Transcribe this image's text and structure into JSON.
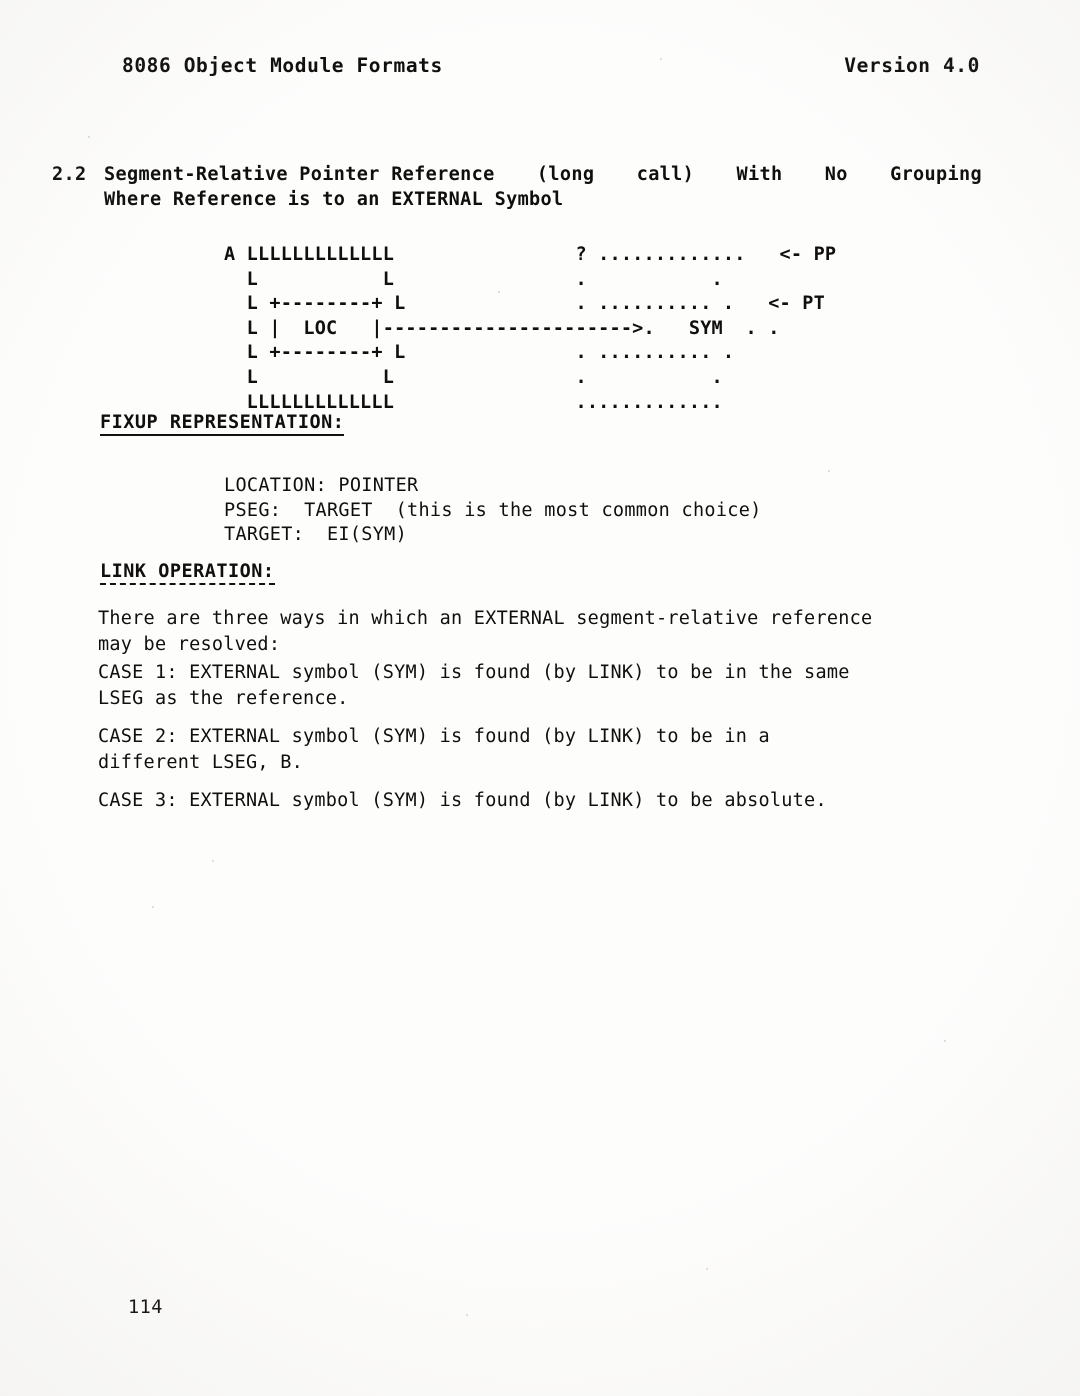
{
  "document": {
    "running_head_left": "8086 Object Module Formats",
    "running_head_right": "Version 4.0",
    "page_number": "114"
  },
  "section": {
    "number": "2.2",
    "title_line1_a": "Segment-Relative Pointer Reference",
    "title_line1_b": "(long",
    "title_line1_c": "call)",
    "title_line1_d": "With",
    "title_line1_e": "No",
    "title_line1_f": "Grouping",
    "title_line2": "Where Reference is to an EXTERNAL Symbol"
  },
  "diagram": {
    "line1": "A LLLLLLLLLLLLL                ? .............   <- PP",
    "line2": "  L           L                .           .",
    "line3": "  L +--------+ L               . .......... .   <- PT",
    "line4": "  L |  LOC   |---------------------->.   SYM  . .",
    "line5": "  L +--------+ L               . .......... .",
    "line6": "  L           L                .           .",
    "line7": "  LLLLLLLLLLLLL                .............",
    "labels": {
      "box_label": "LOC",
      "symbol_label": "SYM",
      "frame_label": "A",
      "unknown_frame": "?",
      "pointer_pointer": "<- PP",
      "pointer_target": "<- PT"
    }
  },
  "fixup": {
    "heading": "FIXUP REPRESENTATION:",
    "line_location": "LOCATION: POINTER",
    "line_pseg": "PSEG:  TARGET  (this is the most common choice)",
    "line_target": "TARGET:  EI(SYM)"
  },
  "link_operation": {
    "heading": "LINK OPERATION:",
    "intro_line1": "There  are three ways in which an EXTERNAL segment-relative reference",
    "intro_line2": "may be resolved:",
    "case1_line1": "CASE 1:  EXTERNAL symbol (SYM) is found (by LINK) to be in  the  same",
    "case1_line2": "LSEG as the reference.",
    "case2_line1": "CASE  2:   EXTERNAL  symbol  (SYM)  is  found  (by  LINK)  to be in a",
    "case2_line2": "different LSEG, B.",
    "case3_line1": "CASE 3:  EXTERNAL symbol (SYM) is found (by LINK) to be absolute."
  },
  "colors": {
    "ink": "#100f0d",
    "paper": "#fdfdfc"
  }
}
